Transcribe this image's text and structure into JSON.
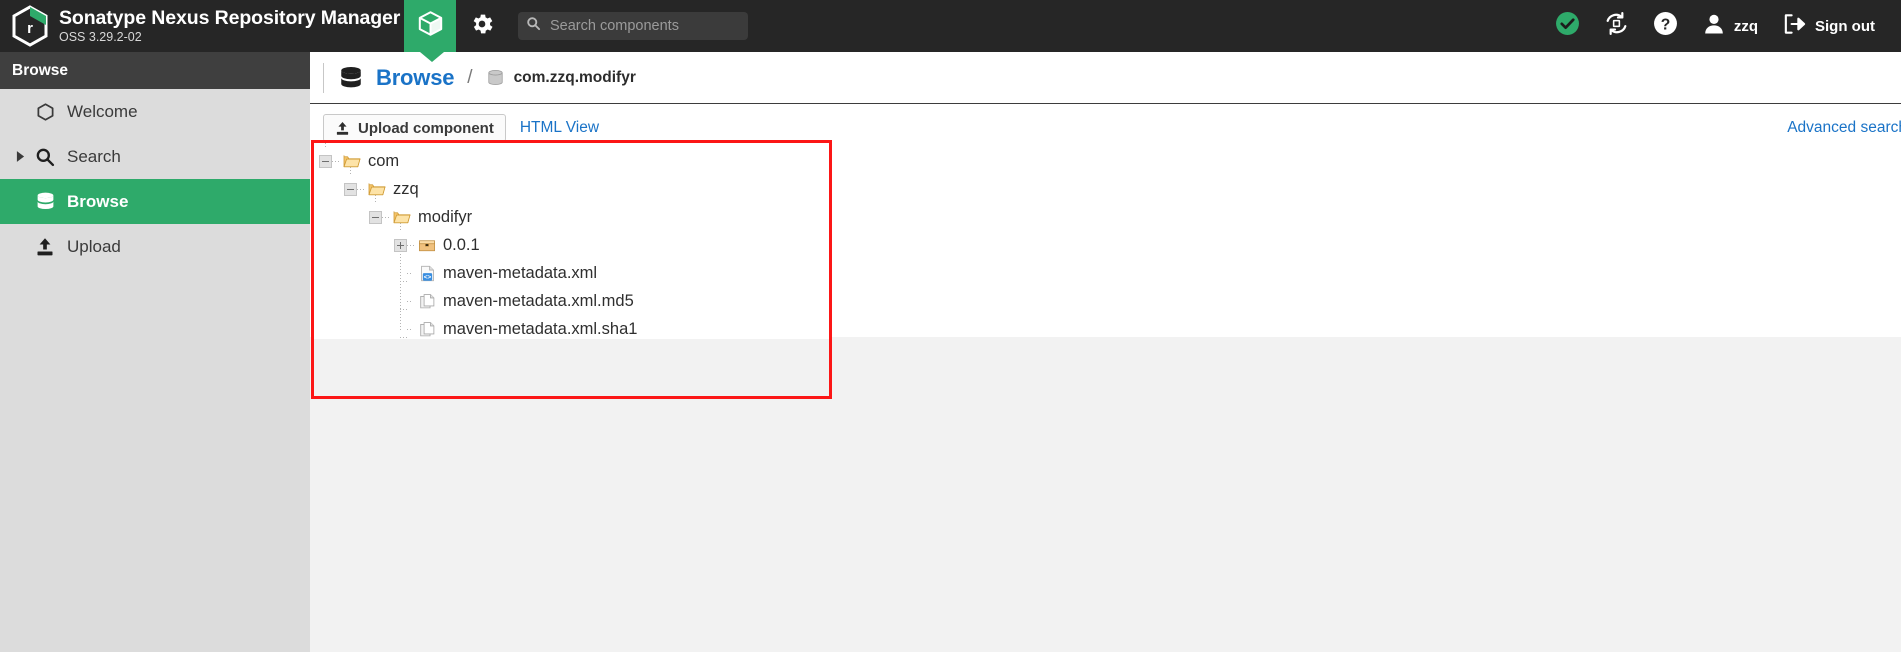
{
  "header": {
    "brand_title": "Sonatype Nexus Repository Manager",
    "brand_subtitle": "OSS 3.29.2-02",
    "logo_icon": "nexus-hexagon-logo",
    "browse_tile_icon": "cube-box-icon",
    "settings_tile_icon": "gear-icon",
    "search": {
      "placeholder": "Search components",
      "value": "",
      "icon": "search-icon"
    },
    "status_icon": "check-circle-icon",
    "refresh_icon": "refresh-sync-icon",
    "help_icon": "question-circle-icon",
    "user_icon": "user-avatar-icon",
    "user_name": "zzq",
    "signout_icon": "sign-out-icon",
    "signout_label": "Sign out",
    "accent_green": "#2eaa6a",
    "bar_background": "#262626"
  },
  "sidebar": {
    "title": "Browse",
    "items": [
      {
        "label": "Welcome",
        "icon": "hexagon-outline-icon",
        "selected": false,
        "has_caret": false
      },
      {
        "label": "Search",
        "icon": "search-icon",
        "selected": false,
        "has_caret": true
      },
      {
        "label": "Browse",
        "icon": "database-stack-icon",
        "selected": true,
        "has_caret": false
      },
      {
        "label": "Upload",
        "icon": "upload-icon",
        "selected": false,
        "has_caret": false
      }
    ]
  },
  "breadcrumb": {
    "icon": "database-stack-icon",
    "root_label": "Browse",
    "separator": "/",
    "leaf_icon": "repository-icon",
    "leaf_label": "com.zzq.modifyr"
  },
  "toolbar": {
    "upload_button_label": "Upload component",
    "upload_button_icon": "upload-icon",
    "html_view_label": "HTML View",
    "advanced_search_label": "Advanced search"
  },
  "tree": {
    "highlight_color": "#fc1616",
    "nodes": [
      {
        "label": "com",
        "depth": 0,
        "toggle": "minus",
        "icon": "folder-open-icon",
        "type": "folder"
      },
      {
        "label": "zzq",
        "depth": 1,
        "toggle": "minus",
        "icon": "folder-open-icon",
        "type": "folder"
      },
      {
        "label": "modifyr",
        "depth": 2,
        "toggle": "minus",
        "icon": "folder-open-icon",
        "type": "folder"
      },
      {
        "label": "0.0.1",
        "depth": 3,
        "toggle": "plus",
        "icon": "package-box-icon",
        "type": "component"
      },
      {
        "label": "maven-metadata.xml",
        "depth": 3,
        "toggle": "none",
        "icon": "xml-file-icon",
        "type": "file"
      },
      {
        "label": "maven-metadata.xml.md5",
        "depth": 3,
        "toggle": "none",
        "icon": "copy-file-icon",
        "type": "file"
      },
      {
        "label": "maven-metadata.xml.sha1",
        "depth": 3,
        "toggle": "none",
        "icon": "copy-file-icon",
        "type": "file"
      }
    ]
  }
}
